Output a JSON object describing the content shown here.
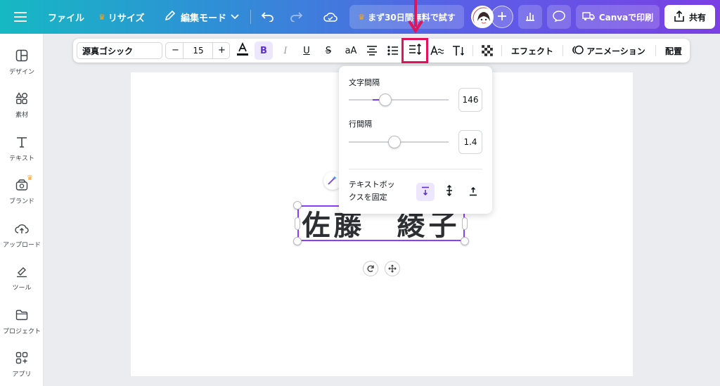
{
  "topbar": {
    "file_label": "ファイル",
    "resize_label": "リサイズ",
    "edit_mode_label": "編集モード",
    "trial_label": "まず30日間無料で試す",
    "print_label": "Canvaで印刷",
    "share_label": "共有"
  },
  "sidebar": {
    "items": [
      {
        "label": "デザイン"
      },
      {
        "label": "素材"
      },
      {
        "label": "テキスト"
      },
      {
        "label": "ブランド"
      },
      {
        "label": "アップロード"
      },
      {
        "label": "ツール"
      },
      {
        "label": "プロジェクト"
      },
      {
        "label": "アプリ"
      }
    ]
  },
  "text_toolbar": {
    "font_name": "源真ゴシック",
    "font_size": "15",
    "minus": "−",
    "plus": "+",
    "bold": "B",
    "italic": "I",
    "underline": "U",
    "strike": "S",
    "case": "aA",
    "effects_label": "エフェクト",
    "animation_label": "アニメーション",
    "position_label": "配置"
  },
  "spacing_popover": {
    "letter_spacing_label": "文字間隔",
    "letter_spacing_value": "146",
    "line_spacing_label": "行間隔",
    "line_spacing_value": "1.4",
    "anchor_label_line1": "テキストボッ",
    "anchor_label_line2": "クスを固定"
  },
  "canvas": {
    "name_text": "佐藤　綾子"
  },
  "colors": {
    "accent": "#7b3fe4",
    "highlight": "#e0135b",
    "selection": "#8b3dff"
  }
}
